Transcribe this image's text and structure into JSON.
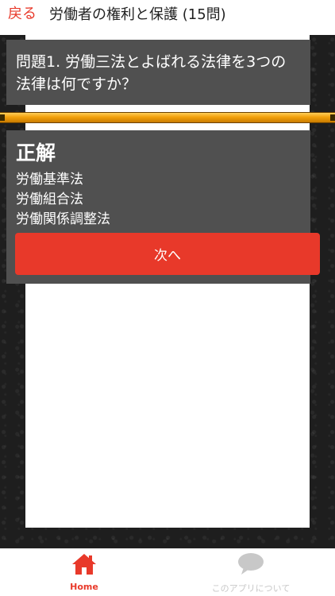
{
  "header": {
    "back_label": "戻る",
    "title": "労働者の権利と保護 (15問)"
  },
  "question": {
    "text": "問題1. 労働三法とよばれる法律を3つの法律は何ですか？"
  },
  "answer": {
    "heading": "正解",
    "lines": [
      "労働基準法",
      "労働組合法",
      "労働関係調整法"
    ]
  },
  "next_button_label": "次へ",
  "bottom_nav": {
    "home_label": "Home",
    "about_label": "このアプリについて"
  },
  "colors": {
    "accent": "#e8392a",
    "panel": "#505050",
    "bar": "#f2a10c",
    "inactive": "#c8c8c8"
  },
  "icons": {
    "home": "home-icon",
    "about": "speech-bubble-icon"
  }
}
